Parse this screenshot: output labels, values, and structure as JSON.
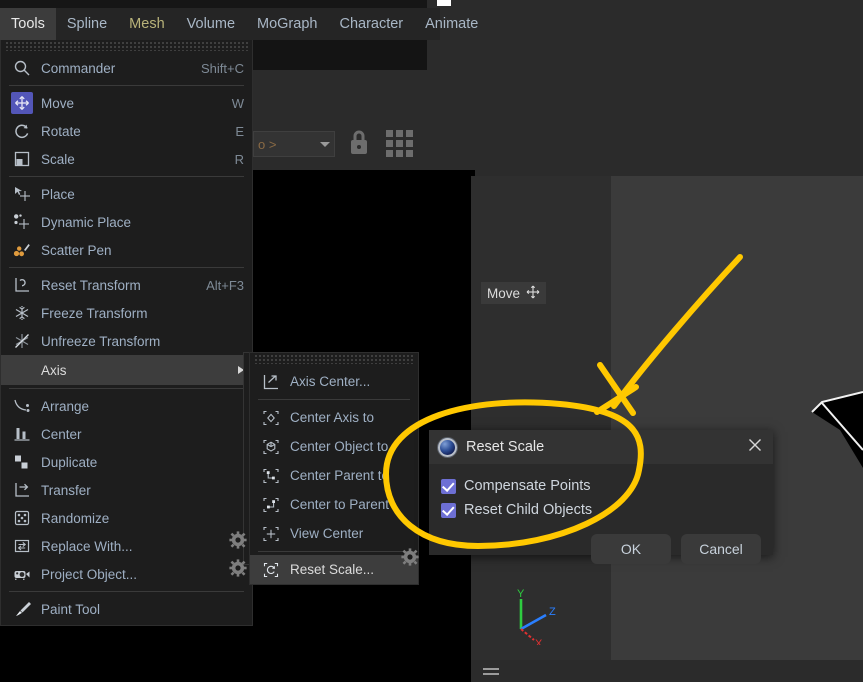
{
  "app": {
    "name": "Cinema 4D",
    "accent_yellow": "#FFC800",
    "menu_bg": "#1d1d1d",
    "highlight_bg": "#3d3d3d"
  },
  "menubar": {
    "tabs": [
      {
        "label": "Tools",
        "active": true
      },
      {
        "label": "Spline",
        "active": false
      },
      {
        "label": "Mesh",
        "active": false
      },
      {
        "label": "Volume",
        "active": false
      },
      {
        "label": "MoGraph",
        "active": false
      },
      {
        "label": "Character",
        "active": false
      },
      {
        "label": "Animate",
        "active": false
      }
    ]
  },
  "tools_menu": {
    "groups": [
      {
        "items": [
          {
            "label": "Commander",
            "shortcut": "Shift+C",
            "icon": "search-icon"
          }
        ]
      },
      {
        "items": [
          {
            "label": "Move",
            "shortcut": "W",
            "icon": "move-icon",
            "selected": true
          },
          {
            "label": "Rotate",
            "shortcut": "E",
            "icon": "rotate-icon"
          },
          {
            "label": "Scale",
            "shortcut": "R",
            "icon": "scale-icon"
          }
        ]
      },
      {
        "items": [
          {
            "label": "Place",
            "shortcut": "",
            "icon": "place-icon"
          },
          {
            "label": "Dynamic Place",
            "shortcut": "",
            "icon": "dynamic-place-icon"
          },
          {
            "label": "Scatter Pen",
            "shortcut": "",
            "icon": "scatter-pen-icon"
          }
        ]
      },
      {
        "items": [
          {
            "label": "Reset Transform",
            "shortcut": "Alt+F3",
            "icon": "reset-transform-icon"
          },
          {
            "label": "Freeze Transform",
            "shortcut": "",
            "icon": "freeze-transform-icon"
          },
          {
            "label": "Unfreeze Transform",
            "shortcut": "",
            "icon": "unfreeze-transform-icon"
          },
          {
            "label": "Axis",
            "shortcut": "",
            "icon": "",
            "submenu": true,
            "highlighted": true
          }
        ]
      },
      {
        "items": [
          {
            "label": "Arrange",
            "shortcut": "",
            "icon": "arrange-icon"
          },
          {
            "label": "Center",
            "shortcut": "",
            "icon": "center-icon"
          },
          {
            "label": "Duplicate",
            "shortcut": "",
            "icon": "duplicate-icon"
          },
          {
            "label": "Transfer",
            "shortcut": "",
            "icon": "transfer-icon"
          },
          {
            "label": "Randomize",
            "shortcut": "",
            "icon": "randomize-icon"
          },
          {
            "label": "Replace With...",
            "shortcut": "",
            "icon": "replace-with-icon",
            "gear": true
          },
          {
            "label": "Project Object...",
            "shortcut": "",
            "icon": "project-object-icon",
            "gear": true
          }
        ]
      },
      {
        "items": [
          {
            "label": "Paint Tool",
            "shortcut": "",
            "icon": "paint-tool-icon"
          }
        ]
      }
    ]
  },
  "axis_submenu": {
    "groups": [
      {
        "items": [
          {
            "label": "Axis Center...",
            "icon": "axis-center-icon"
          }
        ]
      },
      {
        "items": [
          {
            "label": "Center Axis to",
            "icon": "center-axis-to-icon"
          },
          {
            "label": "Center Object to",
            "icon": "center-object-to-icon"
          },
          {
            "label": "Center Parent to",
            "icon": "center-parent-to-icon"
          },
          {
            "label": "Center to Parent",
            "icon": "center-to-parent-icon"
          },
          {
            "label": "View Center",
            "icon": "view-center-icon"
          }
        ]
      },
      {
        "items": [
          {
            "label": "Reset Scale...",
            "icon": "reset-scale-icon",
            "highlighted": true,
            "gear": true
          }
        ]
      }
    ]
  },
  "dialog": {
    "title": "Reset Scale",
    "logo_icon": "c4d-logo-icon",
    "close_icon": "close-icon",
    "checkboxes": [
      {
        "label": "Compensate Points",
        "checked": true
      },
      {
        "label": "Reset Child Objects",
        "checked": true
      }
    ],
    "buttons": [
      {
        "label": "OK"
      },
      {
        "label": "Cancel"
      }
    ]
  },
  "viewport": {
    "tool_chip": {
      "label": "Move",
      "icon": "move-crosshair-icon"
    },
    "gizmo": {
      "axes": [
        {
          "label": "Y",
          "color": "#2ecc40"
        },
        {
          "label": "Z",
          "color": "#2a7fff"
        },
        {
          "label": "X",
          "color": "#e03131"
        }
      ]
    },
    "menu_icon": "hamburger-icon"
  },
  "toolbar": {
    "dropdown_value": "o >",
    "lock_icon": "lock-icon",
    "grid_icon": "grid-icon"
  },
  "annotation": {
    "color": "#FFC800",
    "shapes": [
      "ellipse-highlight",
      "arrow-pointer"
    ]
  }
}
